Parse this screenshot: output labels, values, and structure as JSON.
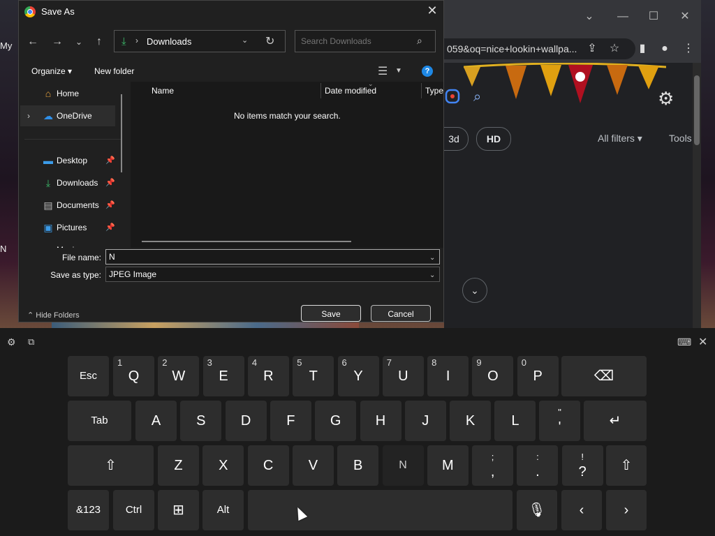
{
  "browser": {
    "url": "059&oq=nice+lookin+wallpa...",
    "filters": {
      "chip_3d": "3d",
      "chip_hd": "HD",
      "all_filters": "All filters",
      "tools": "Tools"
    }
  },
  "left_partial_text": {
    "line1": "My",
    "line2": "N"
  },
  "dialog": {
    "title": "Save As",
    "address": "Downloads",
    "search_placeholder": "Search Downloads",
    "organize": "Organize",
    "new_folder": "New folder",
    "nav": {
      "home": "Home",
      "onedrive": "OneDrive",
      "desktop": "Desktop",
      "downloads": "Downloads",
      "documents": "Documents",
      "pictures": "Pictures",
      "music": "Music"
    },
    "columns": {
      "name": "Name",
      "date": "Date modified",
      "type": "Type"
    },
    "empty_message": "No items match your search.",
    "file_name_label": "File name:",
    "file_name_value": "N",
    "save_as_type_label": "Save as type:",
    "save_as_type_value": "JPEG Image",
    "hide_folders": "Hide Folders",
    "save": "Save",
    "cancel": "Cancel"
  },
  "keyboard": {
    "row1": [
      {
        "label": "Esc"
      },
      {
        "label": "Q",
        "sec": "1"
      },
      {
        "label": "W",
        "sec": "2"
      },
      {
        "label": "E",
        "sec": "3"
      },
      {
        "label": "R",
        "sec": "4"
      },
      {
        "label": "T",
        "sec": "5"
      },
      {
        "label": "Y",
        "sec": "6"
      },
      {
        "label": "U",
        "sec": "7"
      },
      {
        "label": "I",
        "sec": "8"
      },
      {
        "label": "O",
        "sec": "9"
      },
      {
        "label": "P",
        "sec": "0"
      }
    ],
    "row2": [
      {
        "label": "Tab"
      },
      {
        "label": "A"
      },
      {
        "label": "S"
      },
      {
        "label": "D"
      },
      {
        "label": "F"
      },
      {
        "label": "G"
      },
      {
        "label": "H"
      },
      {
        "label": "J"
      },
      {
        "label": "K"
      },
      {
        "label": "L"
      },
      {
        "top": "\"",
        "bot": "'"
      }
    ],
    "row3": [
      {
        "label": "Z"
      },
      {
        "label": "X"
      },
      {
        "label": "C"
      },
      {
        "label": "V"
      },
      {
        "label": "B"
      },
      {
        "label": "N"
      },
      {
        "label": "M"
      },
      {
        "top": ";",
        "bot": ","
      },
      {
        "top": ":",
        "bot": "."
      },
      {
        "top": "!",
        "bot": "?"
      }
    ],
    "row4": [
      {
        "label": "&123"
      },
      {
        "label": "Ctrl"
      },
      {
        "label": "Alt"
      }
    ],
    "pressed_key": "N",
    "icons": {
      "backspace": "backspace-icon",
      "enter": "enter-icon",
      "shift": "shift-icon",
      "windows": "windows-icon",
      "mic": "microphone-icon",
      "left": "left-arrow-icon",
      "right": "right-arrow-icon"
    }
  },
  "colors": {
    "accent": "#1e88e5",
    "downloads_green": "#3cba6a",
    "dialog_bg": "#202020",
    "key_bg": "#2d2d2d"
  }
}
